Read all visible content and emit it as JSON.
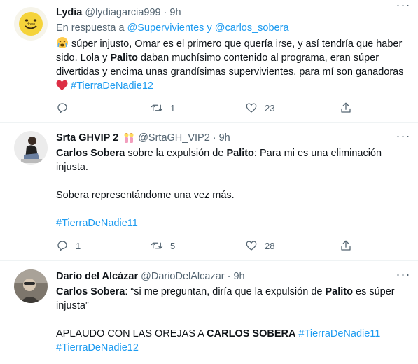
{
  "tweets": [
    {
      "name": "Lydia",
      "handle": "@lydiagarcia999",
      "time": "9h",
      "reply_prefix": "En respuesta a",
      "reply_to_1": "@Supervivientes",
      "reply_and": "y",
      "reply_to_2": "@carlos_sobera",
      "text_1": "súper injusto, Omar es el primero que quería irse, y así tendría que haber sido. Lola y",
      "text_bold_1": "Palito",
      "text_2": "daban muchísimo contenido al programa, eran súper divertidas y encima unas grandísimas supervivientes, para mí son ganadoras",
      "hashtag": "#TierraDeNadie12",
      "reply_count": "",
      "retweet_count": "1",
      "like_count": "23"
    },
    {
      "name": "Srta GHVIP 2",
      "handle": "@SrtaGH_VIP2",
      "time": "9h",
      "bold_1": "Carlos Sobera",
      "text_1": "sobre la expulsión de",
      "bold_2": "Palito",
      "text_2": ": Para mi es una eliminación injusta.",
      "text_3": "Sobera representándome una vez más.",
      "hashtag": "#TierraDeNadie11",
      "reply_count": "1",
      "retweet_count": "5",
      "like_count": "28"
    },
    {
      "name": "Darío del Alcázar",
      "handle": "@DarioDelAlcazar",
      "time": "9h",
      "bold_1": "Carlos Sobera",
      "text_1": ": “si me preguntan, diría que la expulsión de",
      "bold_2": "Palito",
      "text_2": "es súper injusta”",
      "text_3": "APLAUDO CON LAS OREJAS A",
      "bold_3": "CARLOS SOBERA",
      "hashtag_1": "#TierraDeNadie11",
      "hashtag_2": "#TierraDeNadie12"
    }
  ],
  "icons": {
    "reply": "reply-icon",
    "retweet": "retweet-icon",
    "like": "like-icon",
    "share": "share-icon",
    "more": "more-icon"
  },
  "colors": {
    "link": "#1d9bf0",
    "muted": "#536471",
    "heart": "#f4212e"
  }
}
